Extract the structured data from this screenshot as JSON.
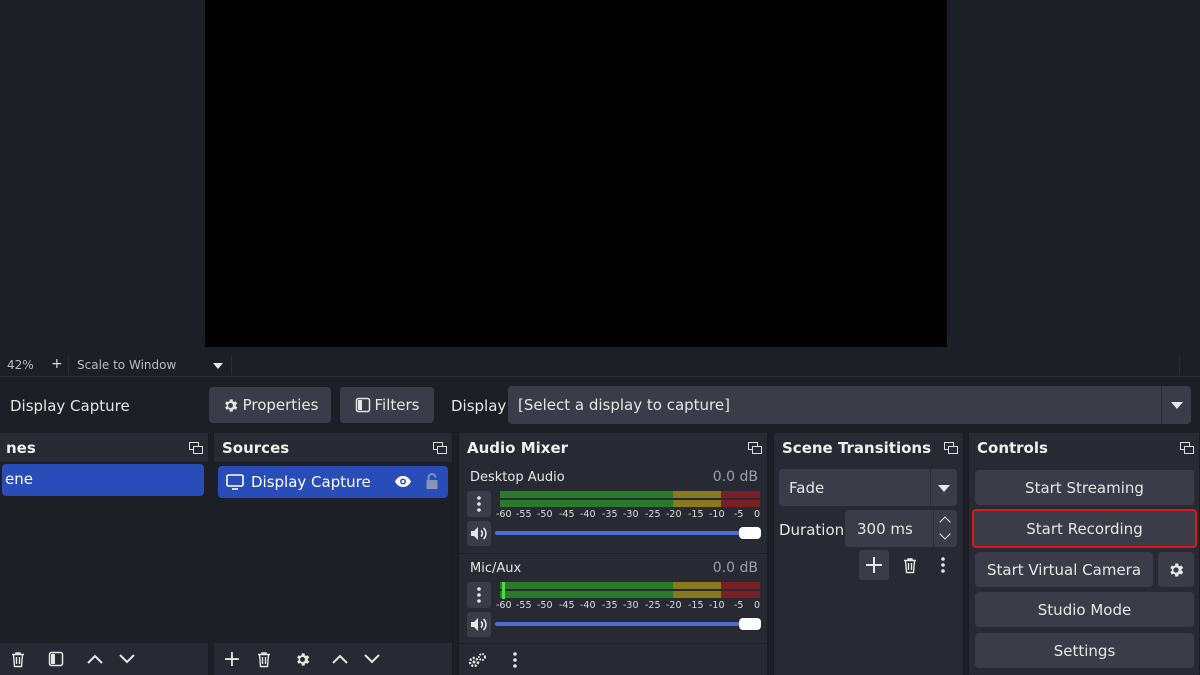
{
  "zoom": {
    "percent": "42%",
    "plus": "+",
    "mode": "Scale to Window"
  },
  "context": {
    "source_name": "Display Capture",
    "properties_label": "Properties",
    "filters_label": "Filters",
    "display_label": "Display",
    "display_value": "[Select a display to capture]"
  },
  "scenes": {
    "title": "nes",
    "selected": "ene"
  },
  "sources": {
    "title": "Sources",
    "items": [
      {
        "label": "Display Capture"
      }
    ]
  },
  "mixer": {
    "title": "Audio Mixer",
    "channels": [
      {
        "name": "Desktop Audio",
        "db": "0.0 dB",
        "level": 0.0
      },
      {
        "name": "Mic/Aux",
        "db": "0.0 dB",
        "level": 0.02
      }
    ],
    "ticks": [
      "-60",
      "-55",
      "-50",
      "-45",
      "-40",
      "-35",
      "-30",
      "-25",
      "-20",
      "-15",
      "-10",
      "-5",
      "0"
    ],
    "fader_level": 1.0
  },
  "transitions": {
    "title": "Scene Transitions",
    "type": "Fade",
    "duration_label": "Duration",
    "duration_value": "300 ms"
  },
  "controls": {
    "title": "Controls",
    "start_streaming": "Start Streaming",
    "start_recording": "Start Recording",
    "start_virtual_camera": "Start Virtual Camera",
    "studio_mode": "Studio Mode",
    "settings": "Settings"
  },
  "colors": {
    "accent": "#284cb8",
    "highlight": "#e0151c",
    "meter_green": "#2b7a2b",
    "meter_yellow": "#8a7a1e",
    "meter_red": "#7a1f24"
  }
}
